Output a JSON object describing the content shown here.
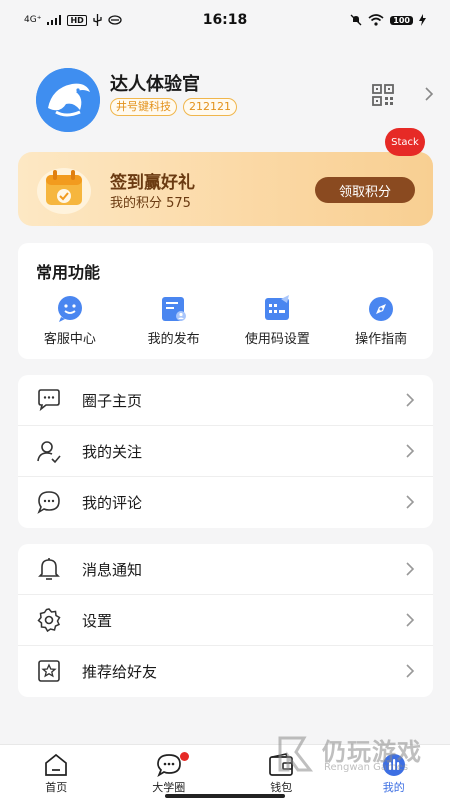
{
  "status_bar": {
    "network": "4G⁺",
    "hd_badge": "HD",
    "time": "16:18",
    "battery": "100"
  },
  "profile": {
    "name": "达人体验官",
    "tags": [
      "井号键科技",
      "212121"
    ]
  },
  "stack_badge": "Stack",
  "checkin": {
    "title": "签到赢好礼",
    "points": "我的积分 575",
    "button": "领取积分"
  },
  "functions": {
    "title": "常用功能",
    "items": [
      {
        "label": "客服中心",
        "icon": "customer-service-icon"
      },
      {
        "label": "我的发布",
        "icon": "my-posts-icon"
      },
      {
        "label": "使用码设置",
        "icon": "code-settings-icon"
      },
      {
        "label": "操作指南",
        "icon": "compass-icon"
      }
    ]
  },
  "list1": [
    {
      "label": "圈子主页",
      "icon": "chat-bubble-icon"
    },
    {
      "label": "我的关注",
      "icon": "user-check-icon"
    },
    {
      "label": "我的评论",
      "icon": "comment-icon"
    }
  ],
  "list2": [
    {
      "label": "消息通知",
      "icon": "bell-icon"
    },
    {
      "label": "设置",
      "icon": "gear-icon"
    },
    {
      "label": "推荐给好友",
      "icon": "star-share-icon"
    }
  ],
  "bottom_nav": [
    {
      "label": "首页",
      "icon": "home-icon",
      "active": false
    },
    {
      "label": "大学圈",
      "icon": "chat-icon",
      "active": false
    },
    {
      "label": "钱包",
      "icon": "wallet-icon",
      "active": false
    },
    {
      "label": "我的",
      "icon": "me-icon",
      "active": true
    }
  ],
  "watermark": {
    "title": "仍玩游戏",
    "subtitle": "Rengwan Games"
  },
  "colors": {
    "accent": "#3d6fe3",
    "tag_orange": "#e3921c",
    "checkin_button": "#8a4a20",
    "badge_red": "#e62a26"
  }
}
